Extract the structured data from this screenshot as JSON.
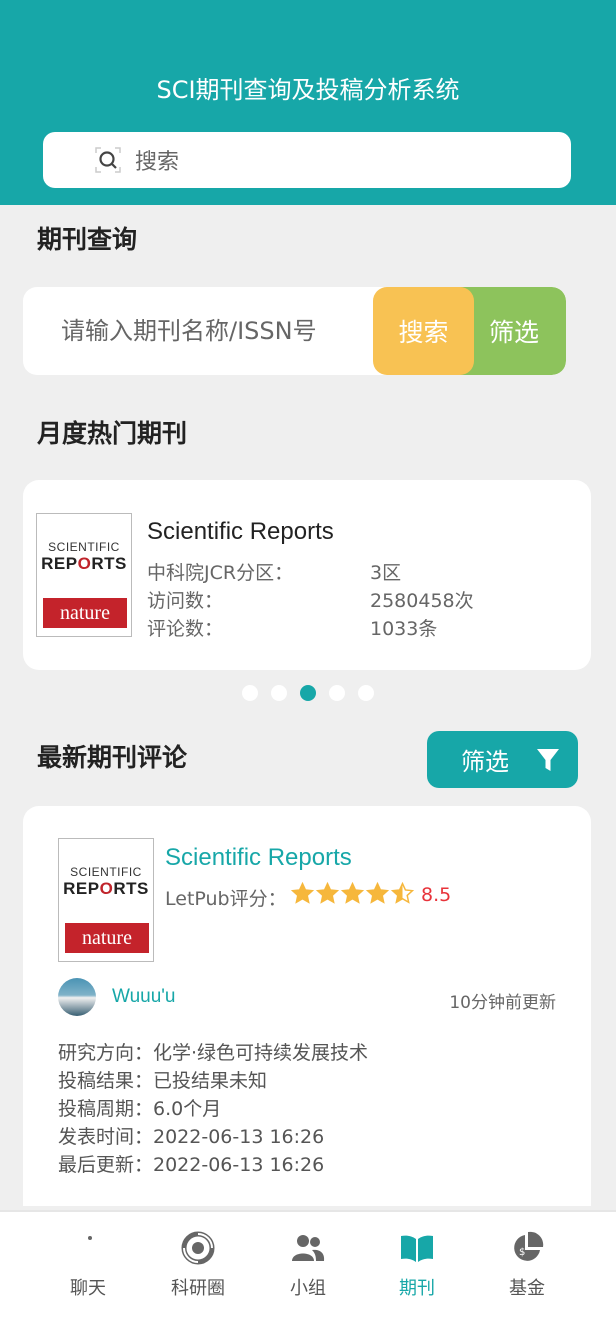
{
  "header": {
    "title": "SCI期刊查询及投稿分析系统",
    "search_placeholder": "搜索"
  },
  "query": {
    "section_title": "期刊查询",
    "input_placeholder": "请输入期刊名称/ISSN号",
    "search_label": "搜索",
    "filter_label": "筛选"
  },
  "hot": {
    "section_title": "月度热门期刊",
    "journal": {
      "cover_line1": "SCIENTIFIC",
      "cover_line2_a": "REP",
      "cover_line2_b": "O",
      "cover_line2_c": "RTS",
      "cover_publisher": "nature",
      "name": "Scientific Reports",
      "rows": [
        {
          "label": "中科院JCR分区：",
          "value": "3区"
        },
        {
          "label": "访问数：",
          "value": "2580458次"
        },
        {
          "label": "评论数：",
          "value": "1033条"
        }
      ]
    },
    "carousel": {
      "count": 5,
      "active_index": 2
    }
  },
  "reviews": {
    "section_title": "最新期刊评论",
    "filter_label": "筛选",
    "item": {
      "journal_name": "Scientific Reports",
      "rating_label": "LetPub评分：",
      "stars": 4.5,
      "score": "8.5",
      "user": "Wuuu'u",
      "updated": "10分钟前更新",
      "details": [
        "研究方向：化学·绿色可持续发展技术",
        "投稿结果：已投结果未知",
        "投稿周期：6.0个月",
        "发表时间：2022-06-13 16:26",
        "最后更新：2022-06-13 16:26"
      ]
    }
  },
  "tabbar": {
    "items": [
      {
        "label": "聊天",
        "icon": "moon-chat-icon"
      },
      {
        "label": "科研圈",
        "icon": "research-circle-icon"
      },
      {
        "label": "小组",
        "icon": "group-icon"
      },
      {
        "label": "期刊",
        "icon": "journal-book-icon"
      },
      {
        "label": "基金",
        "icon": "fund-chart-icon"
      }
    ],
    "active_index": 3
  },
  "colors": {
    "primary": "#17a7a8",
    "search_button": "#f8c253",
    "filter_button": "#8dc35c",
    "star": "#f6b73c",
    "score": "#e8333a"
  }
}
